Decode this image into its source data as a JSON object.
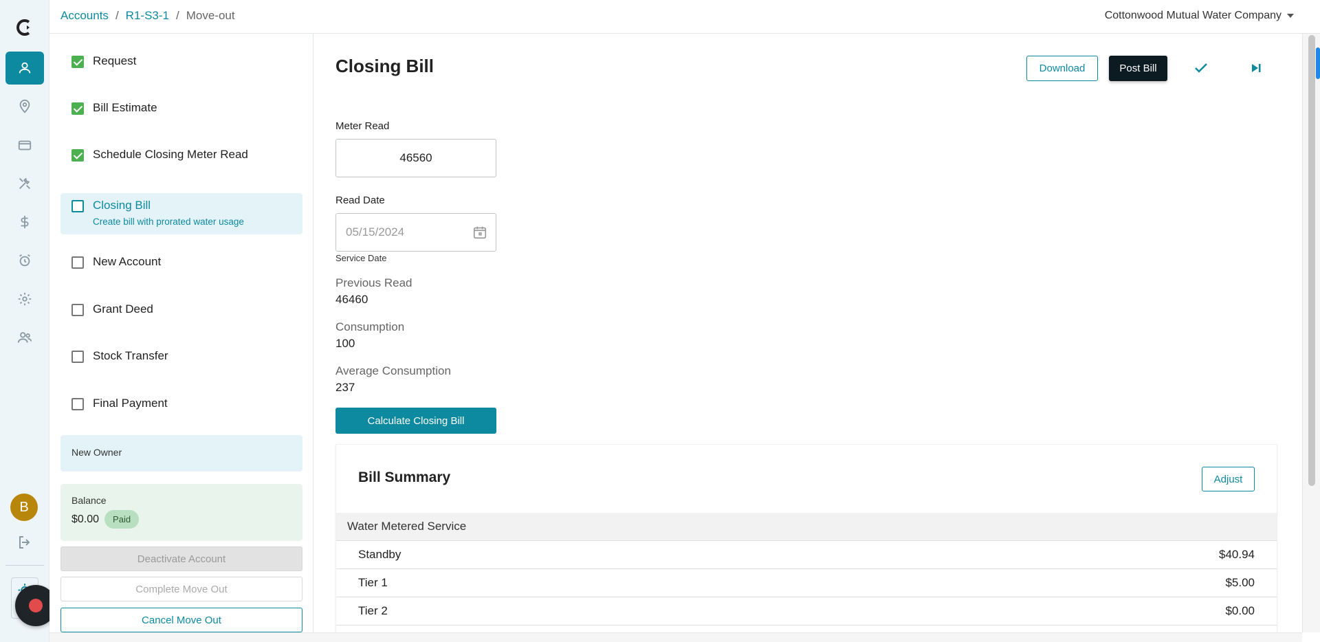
{
  "breadcrumb": {
    "accounts": "Accounts",
    "account_id": "R1-S3-1",
    "current": "Move-out",
    "sep1": "/",
    "sep2": "/"
  },
  "company": {
    "name": "Cottonwood Mutual Water Company"
  },
  "user": {
    "initial": "B"
  },
  "steps": [
    {
      "label": "Request",
      "checked": true
    },
    {
      "label": "Bill Estimate",
      "checked": true
    },
    {
      "label": "Schedule Closing Meter Read",
      "checked": true
    },
    {
      "label": "Closing Bill",
      "subtitle": "Create bill with prorated water usage",
      "checked": false,
      "active": true
    },
    {
      "label": "New Account",
      "checked": false
    },
    {
      "label": "Grant Deed",
      "checked": false
    },
    {
      "label": "Stock Transfer",
      "checked": false
    },
    {
      "label": "Final Payment",
      "checked": false
    }
  ],
  "owner_box": {
    "label": "New Owner"
  },
  "balance": {
    "label": "Balance",
    "amount": "$0.00",
    "status": "Paid"
  },
  "actions": {
    "deactivate": "Deactivate Account",
    "complete": "Complete Move Out",
    "cancel": "Cancel Move Out"
  },
  "main": {
    "title": "Closing Bill",
    "download_label": "Download",
    "post_label": "Post Bill",
    "meter_read": {
      "label": "Meter Read",
      "value": "46560"
    },
    "read_date": {
      "label": "Read Date",
      "value": "05/15/2024",
      "helper": "Service Date"
    },
    "previous_read": {
      "label": "Previous Read",
      "value": "46460"
    },
    "consumption": {
      "label": "Consumption",
      "value": "100"
    },
    "avg_consumption": {
      "label": "Average Consumption",
      "value": "237"
    },
    "calc_label": "Calculate Closing Bill"
  },
  "summary": {
    "title": "Bill Summary",
    "adjust_label": "Adjust",
    "group": "Water Metered Service",
    "rows": [
      {
        "name": "Standby",
        "amount": "$40.94"
      },
      {
        "name": "Tier 1",
        "amount": "$5.00"
      },
      {
        "name": "Tier 2",
        "amount": "$0.00"
      }
    ]
  },
  "colors": {
    "accent": "#0d8aa0",
    "success": "#4caf50",
    "dark": "#0c1a22"
  }
}
